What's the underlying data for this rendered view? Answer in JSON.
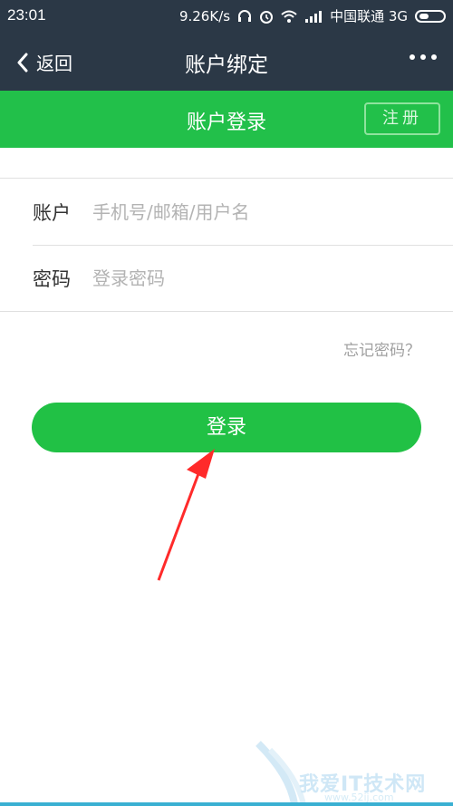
{
  "status_bar": {
    "time": "23:01",
    "speed": "9.26K/s",
    "carrier": "中国联通 3G",
    "icons": [
      "headphone-icon",
      "alarm-icon",
      "wifi-icon",
      "signal-icon",
      "battery-icon"
    ]
  },
  "nav": {
    "back_label": "返回",
    "title": "账户绑定",
    "more_icon": "more-icon"
  },
  "login_header": {
    "title": "账户登录",
    "register_label": "注册"
  },
  "form": {
    "account_label": "账户",
    "account_placeholder": "手机号/邮箱/用户名",
    "password_label": "密码",
    "password_placeholder": "登录密码"
  },
  "forgot_label": "忘记密码？",
  "login_button_label": "登录",
  "watermark": {
    "text": "我爱IT技术网",
    "url": "www.52ij.com"
  },
  "colors": {
    "nav_bg": "#2b3846",
    "green": "#22c04a",
    "arrow": "#ff2a2a"
  }
}
